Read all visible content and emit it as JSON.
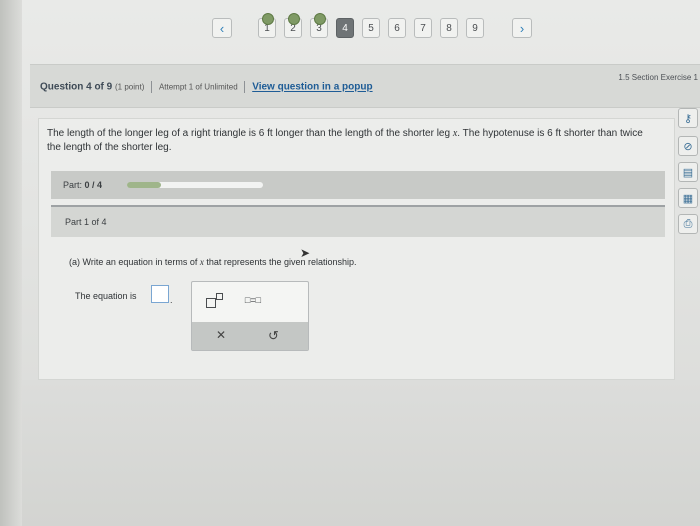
{
  "nav": {
    "prev_glyph": "‹",
    "next_glyph": "›",
    "questions": [
      {
        "label": "1",
        "answered": true,
        "current": false
      },
      {
        "label": "2",
        "answered": true,
        "current": false
      },
      {
        "label": "3",
        "answered": true,
        "current": false
      },
      {
        "label": "4",
        "answered": false,
        "current": true
      },
      {
        "label": "5",
        "answered": false,
        "current": false
      },
      {
        "label": "6",
        "answered": false,
        "current": false
      },
      {
        "label": "7",
        "answered": false,
        "current": false
      },
      {
        "label": "8",
        "answered": false,
        "current": false
      },
      {
        "label": "9",
        "answered": false,
        "current": false
      }
    ]
  },
  "header": {
    "question_label": "Question 4 of 9",
    "points": "(1 point)",
    "attempt": "Attempt 1 of Unlimited",
    "popup_link": "View question in a popup",
    "section": "1.5 Section Exercise 1"
  },
  "problem": {
    "text_a": "The length of the longer leg of a right triangle is 6 ft longer than the length of the shorter leg ",
    "var_x": "x",
    "text_b": ". The hypotenuse is 6 ft shorter than twice the length of the shorter leg."
  },
  "part": {
    "label": "Part:",
    "progress_text": "0 / 4",
    "progress_fraction": 0.25,
    "current_part": "Part 1 of 4"
  },
  "question_a": {
    "prompt_a": "(a) Write an equation in terms of ",
    "var_x": "x",
    "prompt_b": " that represents the given relationship.",
    "equation_label": "The equation is",
    "trailing": "."
  },
  "palette": {
    "equals_symbol": "□=□",
    "clear_glyph": "✕",
    "undo_glyph": "↺"
  },
  "tools": [
    {
      "name": "key-icon",
      "glyph": "⚷"
    },
    {
      "name": "compass-icon",
      "glyph": "⊘"
    },
    {
      "name": "textbook-icon",
      "glyph": "▤"
    },
    {
      "name": "calculator-icon",
      "glyph": "▦"
    },
    {
      "name": "print-icon",
      "glyph": "⎙"
    }
  ]
}
